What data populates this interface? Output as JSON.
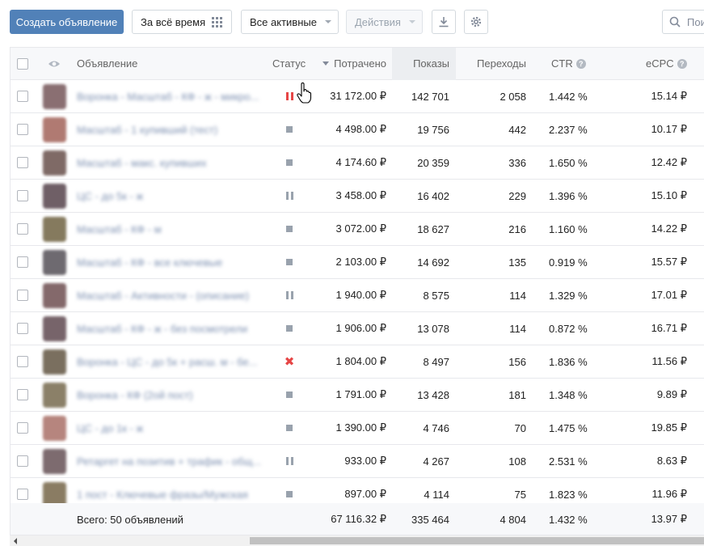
{
  "toolbar": {
    "create_label": "Создать объявление",
    "period_label": "За всё время",
    "filter_label": "Все активные",
    "actions_label": "Действия",
    "search_placeholder": "Пои"
  },
  "table": {
    "headers": {
      "ad": "Объявление",
      "status": "Статус",
      "spent": "Потрачено",
      "shows": "Показы",
      "clicks": "Переходы",
      "ctr": "CTR",
      "ecpc": "eCPC"
    },
    "rows": [
      {
        "name": "Воронка - Масштаб - КФ - ж - микро...",
        "status": "pause-red",
        "spent": "31 172.00 ₽",
        "shows": "142 701",
        "clicks": "2 058",
        "ctr": "1.442 %",
        "ecpc": "15.14 ₽",
        "thumb": "#8a6f72"
      },
      {
        "name": "Масштаб - 1 купивший (тест)",
        "status": "stop",
        "spent": "4 498.00 ₽",
        "shows": "19 756",
        "clicks": "442",
        "ctr": "2.237 %",
        "ecpc": "10.17 ₽",
        "thumb": "#b07a72"
      },
      {
        "name": "Масштаб - макс. купивших",
        "status": "stop",
        "spent": "4 174.60 ₽",
        "shows": "20 359",
        "clicks": "336",
        "ctr": "1.650 %",
        "ecpc": "12.42 ₽",
        "thumb": "#7f6a66"
      },
      {
        "name": "ЦС - до 5к - ж",
        "status": "pause-grey",
        "spent": "3 458.00 ₽",
        "shows": "16 402",
        "clicks": "229",
        "ctr": "1.396 %",
        "ecpc": "15.10 ₽",
        "thumb": "#6f5f66"
      },
      {
        "name": "Масштаб - КФ - м",
        "status": "stop",
        "spent": "3 072.00 ₽",
        "shows": "18 627",
        "clicks": "216",
        "ctr": "1.160 %",
        "ecpc": "14.22 ₽",
        "thumb": "#857a5e"
      },
      {
        "name": "Масштаб - КФ - все ключевые",
        "status": "stop",
        "spent": "2 103.00 ₽",
        "shows": "14 692",
        "clicks": "135",
        "ctr": "0.919 %",
        "ecpc": "15.57 ₽",
        "thumb": "#6e6a70"
      },
      {
        "name": "Масштаб - Активности - (описание)",
        "status": "pause-grey",
        "spent": "1 940.00 ₽",
        "shows": "8 575",
        "clicks": "114",
        "ctr": "1.329 %",
        "ecpc": "17.01 ₽",
        "thumb": "#84696b"
      },
      {
        "name": "Масштаб - КФ - ж - без посмотрели",
        "status": "stop",
        "spent": "1 906.00 ₽",
        "shows": "13 078",
        "clicks": "114",
        "ctr": "0.872 %",
        "ecpc": "16.71 ₽",
        "thumb": "#77646a"
      },
      {
        "name": "Воронка - ЦС - до 5к + расш. м - бе...",
        "status": "x",
        "spent": "1 804.00 ₽",
        "shows": "8 497",
        "clicks": "156",
        "ctr": "1.836 %",
        "ecpc": "11.56 ₽",
        "thumb": "#7a6f5f"
      },
      {
        "name": "Воронка - КФ (2ой пост)",
        "status": "stop",
        "spent": "1 791.00 ₽",
        "shows": "13 428",
        "clicks": "181",
        "ctr": "1.348 %",
        "ecpc": "9.89 ₽",
        "thumb": "#8b8068"
      },
      {
        "name": "ЦС - до 1к - ж",
        "status": "stop",
        "spent": "1 390.00 ₽",
        "shows": "4 746",
        "clicks": "70",
        "ctr": "1.475 %",
        "ecpc": "19.85 ₽",
        "thumb": "#b6857e"
      },
      {
        "name": "Ретаргет на позитив + трафик - общ...",
        "status": "pause-grey",
        "spent": "933.00 ₽",
        "shows": "4 267",
        "clicks": "108",
        "ctr": "2.531 %",
        "ecpc": "8.63 ₽",
        "thumb": "#7d6b6f"
      },
      {
        "name": "1 пост - Ключевые фразы/Мужская",
        "status": "stop",
        "spent": "897.00 ₽",
        "shows": "4 114",
        "clicks": "75",
        "ctr": "1.823 %",
        "ecpc": "11.96 ₽",
        "thumb": "#8a7c63"
      }
    ],
    "totals": {
      "label": "Всего: 50 объявлений",
      "spent": "67 116.32 ₽",
      "shows": "335 464",
      "clicks": "4 804",
      "ctr": "1.432 %",
      "ecpc": "13.97 ₽"
    }
  },
  "colors": {
    "primary": "#5181b8",
    "danger": "#e64646",
    "muted": "#99a2ad"
  }
}
